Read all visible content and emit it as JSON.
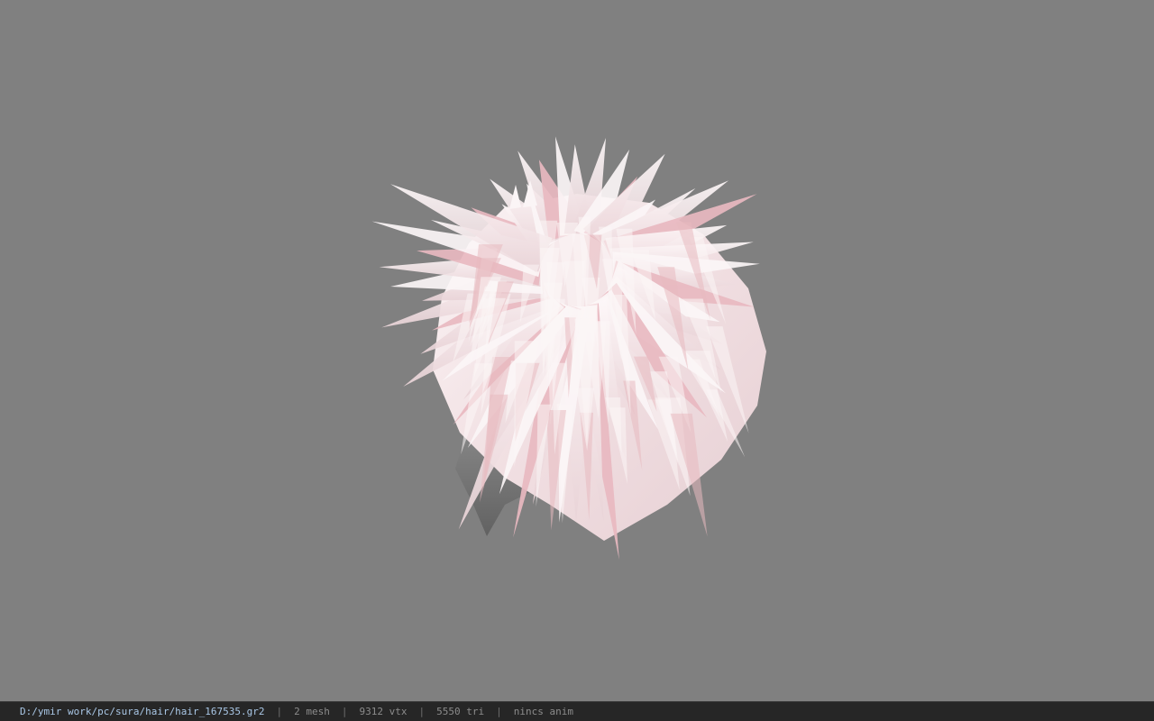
{
  "viewport": {
    "background_color": "#808080",
    "model_colors": {
      "hair_base": "#f3e4e6",
      "hair_highlight": "#fbf5f6",
      "hair_pink": "#e8b9c0",
      "hair_shadow": "#6c6c6c"
    }
  },
  "statusbar": {
    "file_path": "D:/ymir work/pc/sura/hair/hair_167535.gr2",
    "separator": "|",
    "mesh_count": "2 mesh",
    "vertex_count": "9312 vtx",
    "triangle_count": "5550 tri",
    "animation": "nincs anim"
  }
}
